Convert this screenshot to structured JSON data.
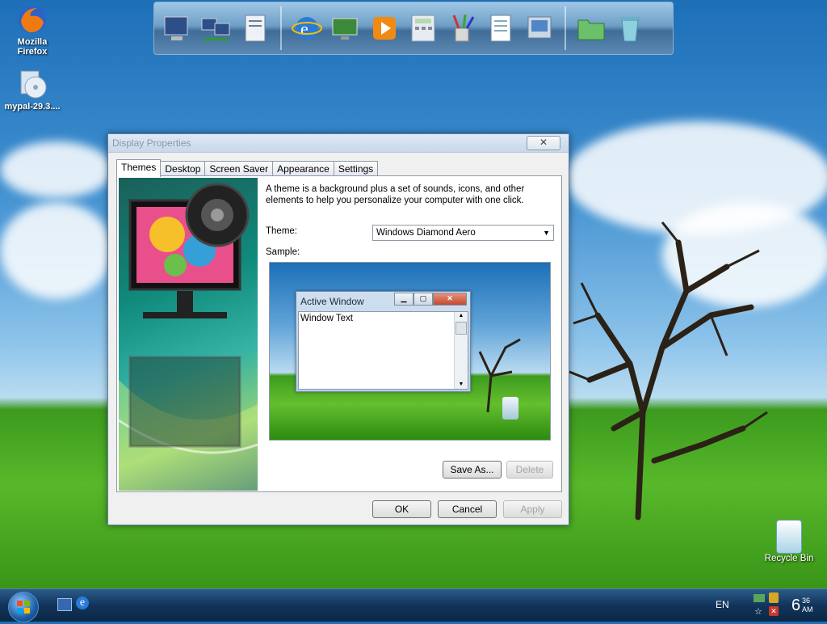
{
  "desktop": {
    "icons": [
      {
        "label_line1": "Mozilla",
        "label_line2": "Firefox",
        "icon": "firefox-icon"
      },
      {
        "label": "mypal-29.3....",
        "icon": "installer-disc-icon"
      }
    ],
    "recycle_bin": {
      "label": "Recycle Bin",
      "icon": "recycle-bin-icon"
    }
  },
  "dock": {
    "items": [
      "my-computer-icon",
      "network-icon",
      "documents-icon",
      "internet-explorer-icon",
      "control-panel-icon",
      "media-player-icon",
      "calculator-icon",
      "paint-tools-icon",
      "notepad-icon",
      "scanner-icon",
      "program-files-icon",
      "recycle-icon"
    ]
  },
  "dialog": {
    "title": "Display Properties",
    "close_label": "✕",
    "tabs": [
      "Themes",
      "Desktop",
      "Screen Saver",
      "Appearance",
      "Settings"
    ],
    "description": "A theme is a background plus a set of sounds, icons, and other elements to help you personalize your computer with one click.",
    "theme_label": "Theme:",
    "theme_value": "Windows Diamond Aero",
    "sample_label": "Sample:",
    "sample": {
      "window_title": "Active Window",
      "window_text": "Window Text"
    },
    "save_as_label": "Save As...",
    "delete_label": "Delete",
    "ok_label": "OK",
    "cancel_label": "Cancel",
    "apply_label": "Apply"
  },
  "taskbar": {
    "language": "EN",
    "clock_hour": "6",
    "clock_minute": "36",
    "clock_ampm": "AM"
  }
}
